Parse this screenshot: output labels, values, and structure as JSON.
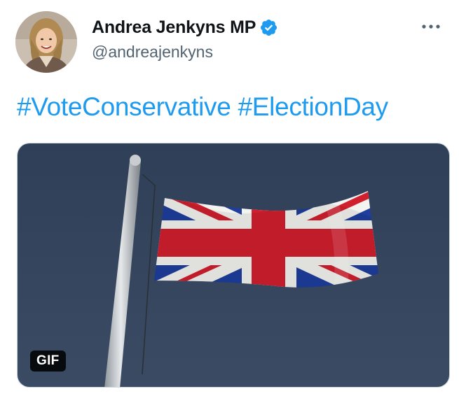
{
  "author": {
    "display_name": "Andrea Jenkyns MP",
    "handle": "@andreajenkyns",
    "verified": true,
    "avatar_icon": "profile-photo"
  },
  "tweet": {
    "hashtags": [
      "#VoteConservative",
      "#ElectionDay"
    ]
  },
  "media": {
    "type": "gif",
    "badge": "GIF",
    "subject": "union-jack-flag-on-pole"
  },
  "colors": {
    "link": "#1d9bf0",
    "verified": "#1d9bf0",
    "name": "#0f1419",
    "handle": "#536471"
  },
  "icons": {
    "more": "more-dots-icon",
    "verified": "verified-badge-icon"
  }
}
